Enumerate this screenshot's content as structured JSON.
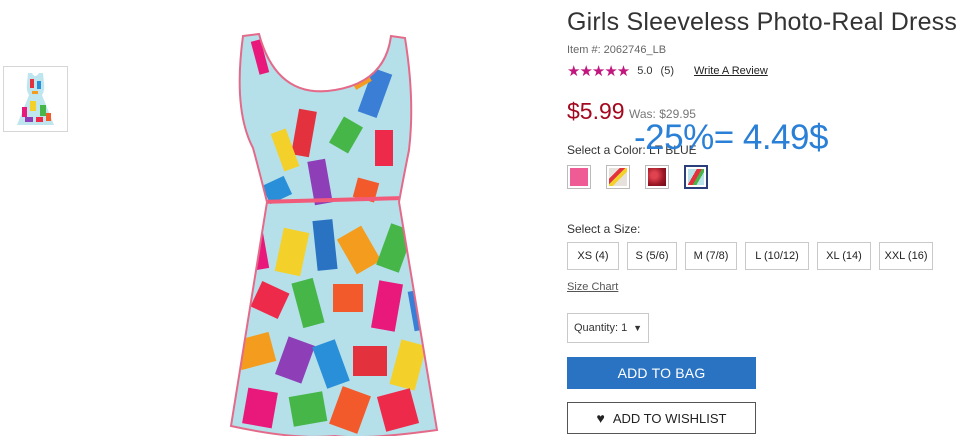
{
  "product": {
    "title": "Girls Sleeveless Photo-Real Dress",
    "item_number": "Item #: 2062746_LB",
    "rating": {
      "stars": "★★★★★",
      "score": "5.0",
      "count": "(5)",
      "write_review": "Write A Review"
    },
    "price": "$5.99",
    "was_price": "Was: $29.95",
    "annotation": "-25%= 4.49$",
    "color_label": "Select a Color: LT BLUE",
    "swatches": [
      {
        "name": "pink",
        "color": "#ef5b94",
        "selected": false
      },
      {
        "name": "print-light",
        "color": "#d8d2cc",
        "selected": false
      },
      {
        "name": "berry-red",
        "color": "#b4222f",
        "selected": false
      },
      {
        "name": "lt-blue",
        "color": "#b9e3ea",
        "selected": true
      }
    ],
    "size_label": "Select a Size:",
    "sizes": [
      "XS (4)",
      "S (5/6)",
      "M (7/8)",
      "L (10/12)",
      "XL (14)",
      "XXL (16)"
    ],
    "size_chart": "Size Chart",
    "quantity": "Quantity: 1",
    "add_to_bag": "ADD TO BAG",
    "add_to_wishlist": "ADD TO WISHLIST"
  },
  "colors": {
    "star": "#c0167e",
    "price": "#a3081e",
    "annotation": "#2a7fd6",
    "bag_button": "#2a73c3",
    "selected_border": "#2a3f7a"
  }
}
